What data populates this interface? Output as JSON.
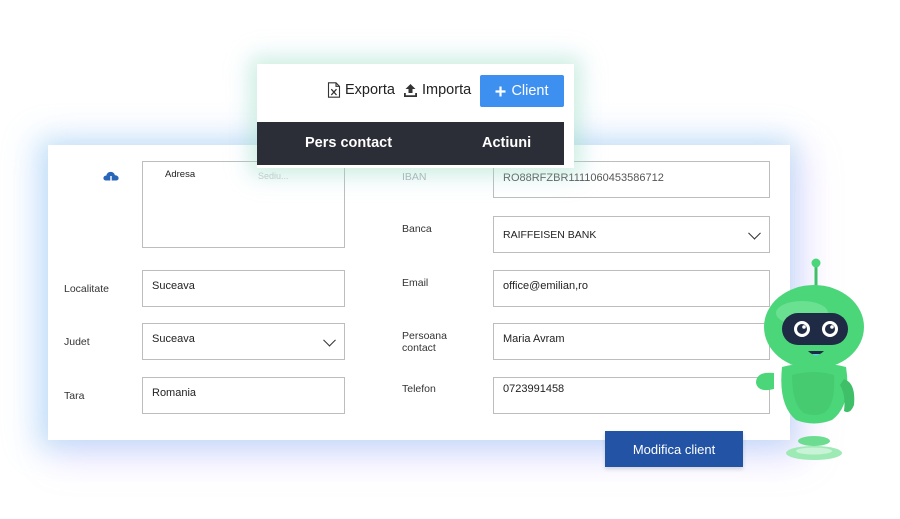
{
  "toolbar": {
    "export_label": "Exporta",
    "import_label": "Importa",
    "client_label": "Client",
    "header_columns": [
      "Pers contact",
      "Actiuni"
    ]
  },
  "form": {
    "left": {
      "address_placeholder": "Adresa",
      "address_behind_text": "Sediu...",
      "locality_label": "Localitate",
      "locality_value": "Suceava",
      "county_label": "Judet",
      "county_value": "Suceava",
      "country_label": "Tara",
      "country_value": "Romania"
    },
    "right": {
      "iban_label": "IBAN",
      "iban_value": "RO88RFZBR1111060453586712",
      "bank_label": "Banca",
      "bank_value": "RAIFFEISEN BANK",
      "email_label": "Email",
      "email_value": "office@emilian,ro",
      "contact_label_line1": "Persoana",
      "contact_label_line2": "contact",
      "contact_value": "Maria Avram",
      "phone_label": "Telefon",
      "phone_value": "0723991458"
    },
    "submit_label": "Modifica client"
  },
  "colors": {
    "primary_button": "#3d8ff0",
    "submit_button": "#2353a4",
    "table_header": "#2b2e36",
    "robot_green": "#4cd67a",
    "upload_icon": "#2a66b8"
  },
  "icons": {
    "export": "excel-file-icon",
    "import": "upload-icon",
    "client": "plus-icon",
    "address": "cloud-upload-icon",
    "select": "chevron-down-icon"
  }
}
